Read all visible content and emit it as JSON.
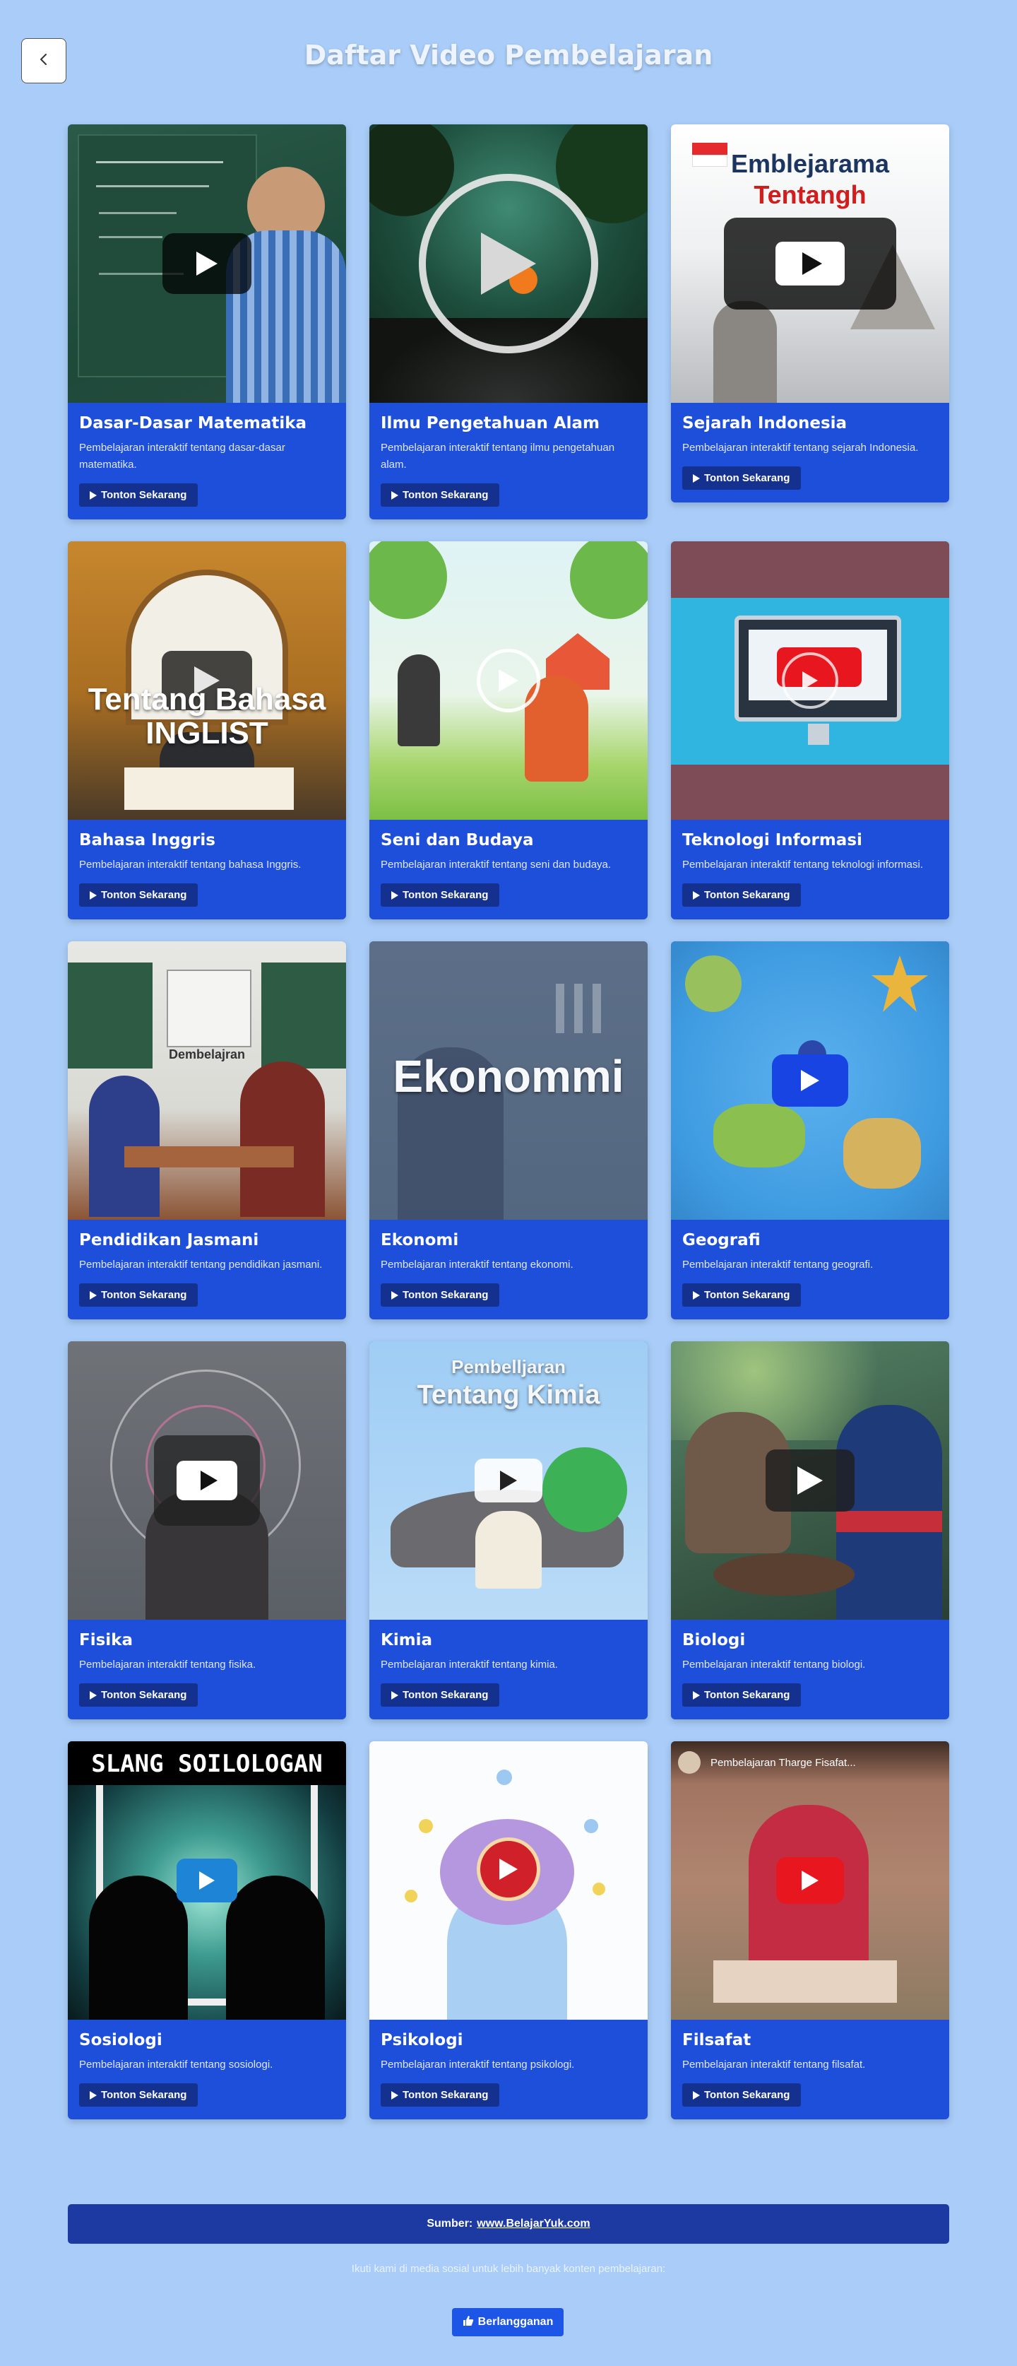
{
  "header": {
    "back_icon": "chevron-left-icon",
    "title": "Daftar Video Pembelajaran"
  },
  "cards": [
    {
      "title": "Dasar-Dasar Matematika",
      "description": "Pembelajaran interaktif tentang dasar-dasar matematika.",
      "button": "Tonton Sekarang",
      "thumb_text": ""
    },
    {
      "title": "Ilmu Pengetahuan Alam",
      "description": "Pembelajaran interaktif tentang ilmu pengetahuan alam.",
      "button": "Tonton Sekarang",
      "thumb_text": ""
    },
    {
      "title": "Sejarah Indonesia",
      "description": "Pembelajaran interaktif tentang sejarah Indonesia.",
      "button": "Tonton Sekarang",
      "thumb_text": "Emblejarama Tentangh"
    },
    {
      "title": "Bahasa Inggris",
      "description": "Pembelajaran interaktif tentang bahasa Inggris.",
      "button": "Tonton Sekarang",
      "thumb_text": "Tentang Bahasa INGLIST"
    },
    {
      "title": "Seni dan Budaya",
      "description": "Pembelajaran interaktif tentang seni dan budaya.",
      "button": "Tonton Sekarang",
      "thumb_text": ""
    },
    {
      "title": "Teknologi Informasi",
      "description": "Pembelajaran interaktif tentang teknologi informasi.",
      "button": "Tonton Sekarang",
      "thumb_text": ""
    },
    {
      "title": "Pendidikan Jasmani",
      "description": "Pembelajaran interaktif tentang pendidikan jasmani.",
      "button": "Tonton Sekarang",
      "thumb_text": "Dembelajran"
    },
    {
      "title": "Ekonomi",
      "description": "Pembelajaran interaktif tentang ekonomi.",
      "button": "Tonton Sekarang",
      "thumb_text": "Ekonommi"
    },
    {
      "title": "Geografi",
      "description": "Pembelajaran interaktif tentang geografi.",
      "button": "Tonton Sekarang",
      "thumb_text": ""
    },
    {
      "title": "Fisika",
      "description": "Pembelajaran interaktif tentang fisika.",
      "button": "Tonton Sekarang",
      "thumb_text": ""
    },
    {
      "title": "Kimia",
      "description": "Pembelajaran interaktif tentang kimia.",
      "button": "Tonton Sekarang",
      "thumb_text": "Pembelljaran Tentang Kimia"
    },
    {
      "title": "Biologi",
      "description": "Pembelajaran interaktif tentang biologi.",
      "button": "Tonton Sekarang",
      "thumb_text": ""
    },
    {
      "title": "Sosiologi",
      "description": "Pembelajaran interaktif tentang sosiologi.",
      "button": "Tonton Sekarang",
      "thumb_text": "SLANG SOILOLOGAN"
    },
    {
      "title": "Psikologi",
      "description": "Pembelajaran interaktif tentang psikologi.",
      "button": "Tonton Sekarang",
      "thumb_text": ""
    },
    {
      "title": "Filsafat",
      "description": "Pembelajaran interaktif tentang filsafat.",
      "button": "Tonton Sekarang",
      "thumb_text": "Pembelajaran Tharge Fisafat..."
    }
  ],
  "footer": {
    "source_label": "Sumber:",
    "source_link": "www.BelajarYuk.com",
    "social_text": "Ikuti kami di media sosial untuk lebih banyak konten pembelajaran:",
    "subscribe_label": "Berlangganan",
    "subscribe_icon": "thumbs-up-icon"
  },
  "colors": {
    "page_background": "#a9cdf8",
    "card_background": "#1e4fdb",
    "button_background": "#15318f",
    "footer_bar": "#1d3aa3",
    "subscribe_button": "#1d55e6",
    "youtube_red": "#e8161e"
  }
}
